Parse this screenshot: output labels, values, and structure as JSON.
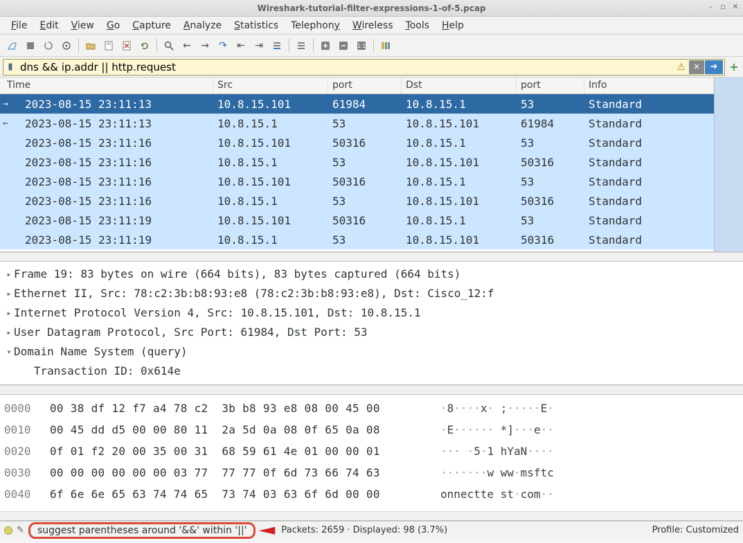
{
  "window": {
    "title": "Wireshark-tutorial-filter-expressions-1-of-5.pcap"
  },
  "menus": [
    "File",
    "Edit",
    "View",
    "Go",
    "Capture",
    "Analyze",
    "Statistics",
    "Telephony",
    "Wireless",
    "Tools",
    "Help"
  ],
  "filter": {
    "value": "dns && ip.addr || http.request",
    "clear_glyph": "✕",
    "apply_glyph": "➜",
    "warn_glyph": "⚠",
    "add_glyph": "+"
  },
  "columns": {
    "time": "Time",
    "src": "Src",
    "sport": "port",
    "dst": "Dst",
    "dport": "port",
    "info": "Info"
  },
  "packets": [
    {
      "arrow": "→",
      "time": "2023-08-15 23:11:13",
      "src": "10.8.15.101",
      "sport": "61984",
      "dst": "10.8.15.1",
      "dport": "53",
      "info": "Standard",
      "selected": true
    },
    {
      "arrow": "←",
      "time": "2023-08-15 23:11:13",
      "src": "10.8.15.1",
      "sport": "53",
      "dst": "10.8.15.101",
      "dport": "61984",
      "info": "Standard"
    },
    {
      "arrow": "",
      "time": "2023-08-15 23:11:16",
      "src": "10.8.15.101",
      "sport": "50316",
      "dst": "10.8.15.1",
      "dport": "53",
      "info": "Standard"
    },
    {
      "arrow": "",
      "time": "2023-08-15 23:11:16",
      "src": "10.8.15.1",
      "sport": "53",
      "dst": "10.8.15.101",
      "dport": "50316",
      "info": "Standard"
    },
    {
      "arrow": "",
      "time": "2023-08-15 23:11:16",
      "src": "10.8.15.101",
      "sport": "50316",
      "dst": "10.8.15.1",
      "dport": "53",
      "info": "Standard"
    },
    {
      "arrow": "",
      "time": "2023-08-15 23:11:16",
      "src": "10.8.15.1",
      "sport": "53",
      "dst": "10.8.15.101",
      "dport": "50316",
      "info": "Standard"
    },
    {
      "arrow": "",
      "time": "2023-08-15 23:11:19",
      "src": "10.8.15.101",
      "sport": "50316",
      "dst": "10.8.15.1",
      "dport": "53",
      "info": "Standard"
    },
    {
      "arrow": "",
      "time": "2023-08-15 23:11:19",
      "src": "10.8.15.1",
      "sport": "53",
      "dst": "10.8.15.101",
      "dport": "50316",
      "info": "Standard"
    }
  ],
  "details": [
    "Frame 19: 83 bytes on wire (664 bits), 83 bytes captured (664 bits)",
    "Ethernet II, Src: 78:c2:3b:b8:93:e8 (78:c2:3b:b8:93:e8), Dst: Cisco_12:f",
    "Internet Protocol Version 4, Src: 10.8.15.101, Dst: 10.8.15.1",
    "User Datagram Protocol, Src Port: 61984, Dst Port: 53",
    "Domain Name System (query)",
    "   Transaction ID: 0x614e"
  ],
  "details_expand": [
    "▸",
    "▸",
    "▸",
    "▸",
    "▾",
    ""
  ],
  "hex": [
    {
      "off": "0000",
      "bytes": "00 38 df 12 f7 a4 78 c2  3b b8 93 e8 08 00 45 00",
      "ascii": "·8····x· ;·····E·"
    },
    {
      "off": "0010",
      "bytes": "00 45 dd d5 00 00 80 11  2a 5d 0a 08 0f 65 0a 08",
      "ascii": "·E······ *]···e··"
    },
    {
      "off": "0020",
      "bytes": "0f 01 f2 20 00 35 00 31  68 59 61 4e 01 00 00 01",
      "ascii": "··· ·5·1 hYaN····"
    },
    {
      "off": "0030",
      "bytes": "00 00 00 00 00 00 03 77  77 77 0f 6d 73 66 74 63",
      "ascii": "·······w ww·msftc"
    },
    {
      "off": "0040",
      "bytes": "6f 6e 6e 65 63 74 74 65  73 74 03 63 6f 6d 00 00",
      "ascii": "onnectte st·com··"
    }
  ],
  "status": {
    "expert_msg": "suggest parentheses around '&&' within '||'",
    "packets": "Packets: 2659 · Displayed: 98 (3.7%)",
    "profile": "Profile: Customized"
  }
}
